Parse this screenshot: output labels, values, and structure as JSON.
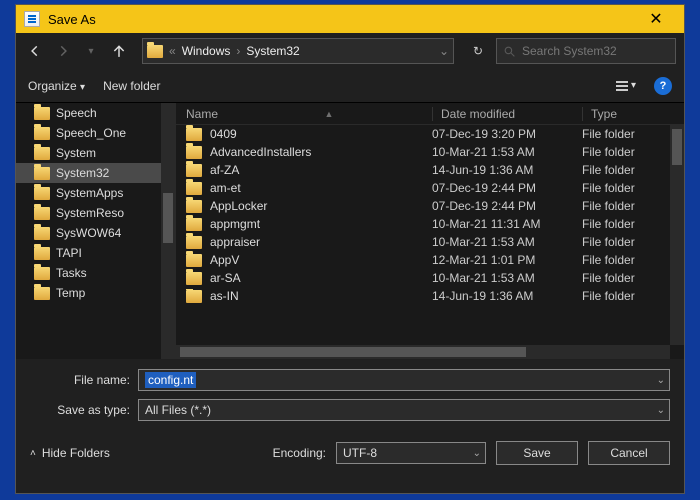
{
  "title": "Save As",
  "breadcrumb": {
    "prefix": "«",
    "seg1": "Windows",
    "seg2": "System32"
  },
  "search": {
    "placeholder": "Search System32"
  },
  "toolbar": {
    "organize": "Organize",
    "newfolder": "New folder"
  },
  "columns": {
    "name": "Name",
    "date": "Date modified",
    "type": "Type"
  },
  "tree": [
    {
      "label": "Speech"
    },
    {
      "label": "Speech_One"
    },
    {
      "label": "System"
    },
    {
      "label": "System32",
      "selected": true
    },
    {
      "label": "SystemApps"
    },
    {
      "label": "SystemReso"
    },
    {
      "label": "SysWOW64"
    },
    {
      "label": "TAPI"
    },
    {
      "label": "Tasks"
    },
    {
      "label": "Temp"
    }
  ],
  "rows": [
    {
      "name": "0409",
      "date": "07-Dec-19 3:20 PM",
      "type": "File folder"
    },
    {
      "name": "AdvancedInstallers",
      "date": "10-Mar-21 1:53 AM",
      "type": "File folder"
    },
    {
      "name": "af-ZA",
      "date": "14-Jun-19 1:36 AM",
      "type": "File folder"
    },
    {
      "name": "am-et",
      "date": "07-Dec-19 2:44 PM",
      "type": "File folder"
    },
    {
      "name": "AppLocker",
      "date": "07-Dec-19 2:44 PM",
      "type": "File folder"
    },
    {
      "name": "appmgmt",
      "date": "10-Mar-21 11:31 AM",
      "type": "File folder"
    },
    {
      "name": "appraiser",
      "date": "10-Mar-21 1:53 AM",
      "type": "File folder"
    },
    {
      "name": "AppV",
      "date": "12-Mar-21 1:01 PM",
      "type": "File folder"
    },
    {
      "name": "ar-SA",
      "date": "10-Mar-21 1:53 AM",
      "type": "File folder"
    },
    {
      "name": "as-IN",
      "date": "14-Jun-19 1:36 AM",
      "type": "File folder"
    }
  ],
  "form": {
    "filename_label": "File name:",
    "filename_value": "config.nt",
    "saveastype_label": "Save as type:",
    "saveastype_value": "All Files  (*.*)"
  },
  "footer": {
    "hidefolders": "Hide Folders",
    "encoding_label": "Encoding:",
    "encoding_value": "UTF-8",
    "save": "Save",
    "cancel": "Cancel"
  }
}
